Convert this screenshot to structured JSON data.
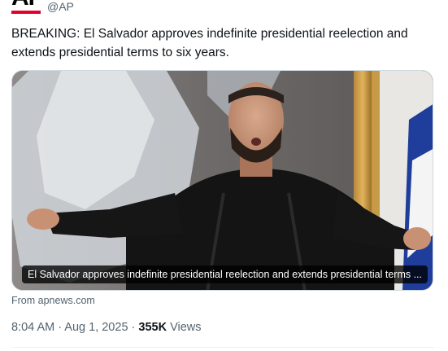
{
  "account": {
    "logo_text": "AP",
    "handle": "@AP"
  },
  "tweet": {
    "text": "BREAKING: El Salvador approves indefinite presidential reelection and extends presidential terms to six years."
  },
  "media": {
    "caption": "El Salvador approves indefinite presidential reelection and extends presidential terms ...",
    "source": "From apnews.com"
  },
  "meta": {
    "time": "8:04 AM",
    "separator": " · ",
    "date": "Aug 1, 2025",
    "separator2": " · ",
    "views_count": "355K",
    "views_label": " Views"
  },
  "colors": {
    "brand_red": "#e4002b",
    "text_primary": "#0f1419",
    "text_secondary": "#536471"
  }
}
